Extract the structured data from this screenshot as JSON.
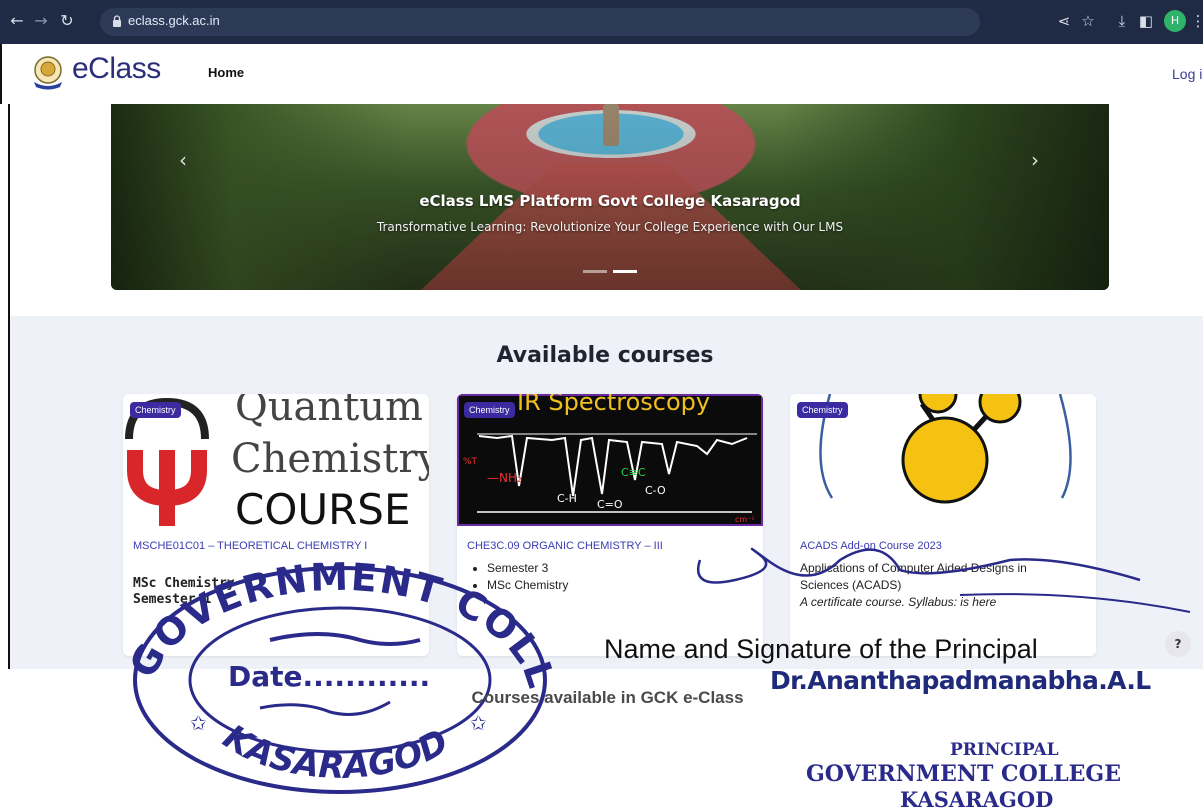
{
  "browser": {
    "url": "eclass.gck.ac.in",
    "profile_initial": "H"
  },
  "header": {
    "brand": "eClass",
    "nav_home": "Home",
    "login": "Log in"
  },
  "hero": {
    "title": "eClass LMS Platform Govt College Kasaragod",
    "subtitle": "Transformative Learning: Revolutionize Your College Experience with Our LMS"
  },
  "courses": {
    "heading": "Available courses",
    "items": [
      {
        "category": "Chemistry",
        "image_text": [
          "Quantum",
          "Chemistry",
          "COURSE"
        ],
        "title": "MSCHE01C01 – THEORETICAL CHEMISTRY I",
        "lines": [
          "MSc Chemistry",
          "Semester 1"
        ]
      },
      {
        "category": "Chemistry",
        "image_text": [
          "IR Spectroscopy"
        ],
        "title": "CHE3C.09 ORGANIC CHEMISTRY – III",
        "bullets": [
          "Semester 3",
          "MSc Chemistry"
        ]
      },
      {
        "category": "Chemistry",
        "title": "ACADS Add-on Course 2023",
        "description_line1": "Applications of Computer Aided Designs in",
        "description_line2": "Sciences (ACADS)",
        "description_line3": "A certificate course. Syllabus: is here"
      }
    ]
  },
  "annotations": {
    "caption": "Courses available in GCK e-Class",
    "principal_label": "Name and Signature of the Principal",
    "principal_name": "Dr.Ananthapadmanabha.A.L",
    "seal_top": "GOVERNMENT COLLEGE",
    "seal_bottom": "KASARAGOD",
    "seal_date": "Date............",
    "stamp_line1": "PRINCIPAL",
    "stamp_line2": "GOVERNMENT COLLEGE",
    "stamp_line3": "KASARAGOD"
  },
  "colors": {
    "accent": "#3b2aa0",
    "link": "#3b3bb0",
    "ink": "#2a2a8a"
  }
}
